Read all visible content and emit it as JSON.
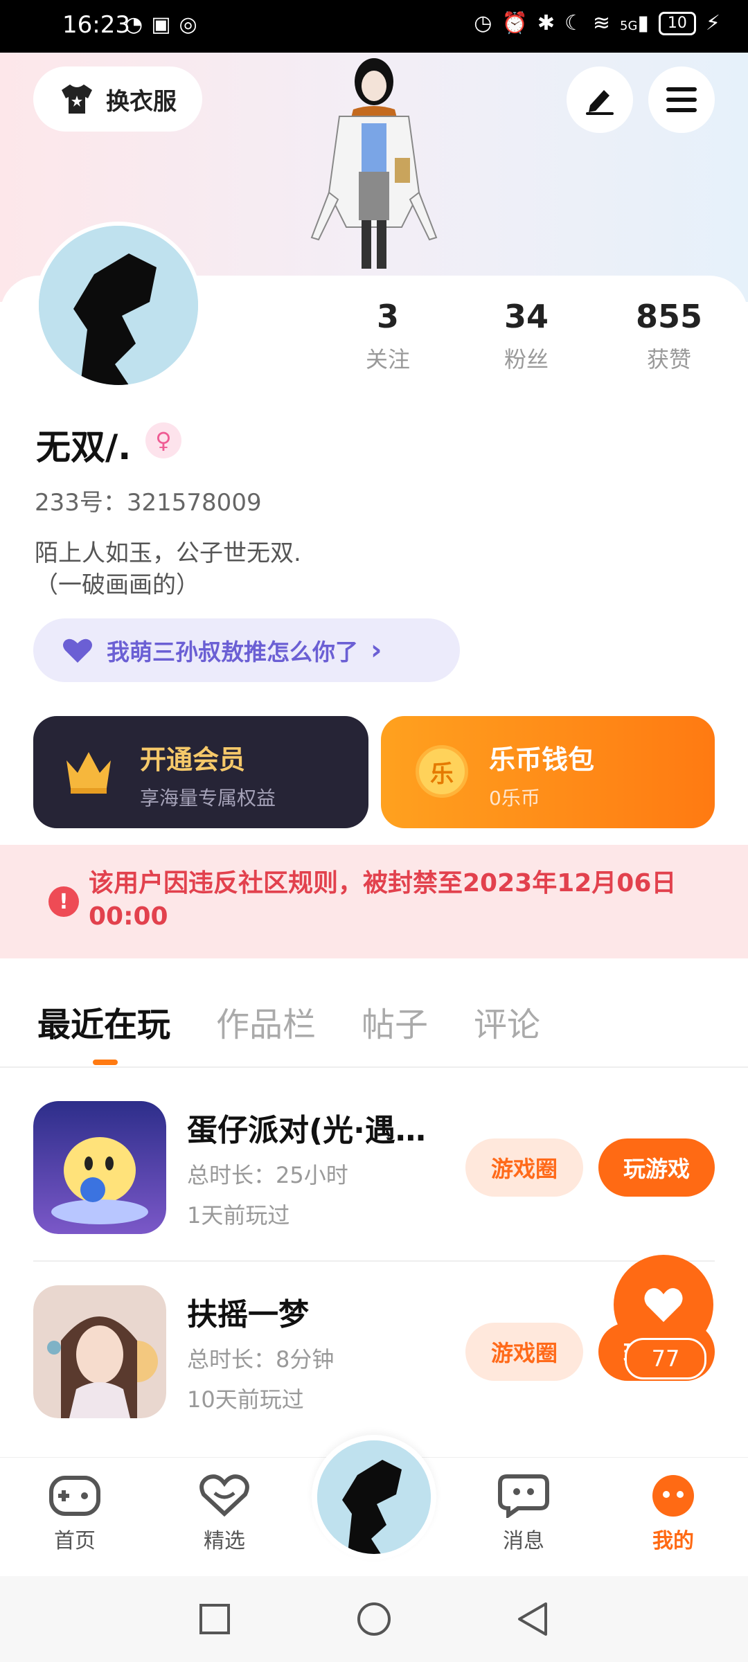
{
  "status_bar": {
    "time": "16:23",
    "battery": "10",
    "signal": "5G"
  },
  "header": {
    "outfit_label": "换衣服"
  },
  "profile": {
    "stats": [
      {
        "value": "3",
        "label": "关注"
      },
      {
        "value": "34",
        "label": "粉丝"
      },
      {
        "value": "855",
        "label": "获赞"
      }
    ],
    "name": "无双/.",
    "gender_symbol": "♀",
    "uid": "233号：321578009",
    "bio_line1": "陌上人如玉，公子世无双.",
    "bio_line2": "（一破画画的）",
    "tag_label": "我萌三孙叔敖推怎么你了",
    "tag_chevron": "›"
  },
  "cards": {
    "vip_title": "开通会员",
    "vip_sub": "享海量专属权益",
    "wallet_title": "乐币钱包",
    "wallet_sub": "0乐币",
    "wallet_coin": "乐"
  },
  "ban_notice": {
    "icon": "!",
    "text": "该用户因违反社区规则，被封禁至2023年12月06日 00:00"
  },
  "tabs": [
    "最近在玩",
    "作品栏",
    "帖子",
    "评论"
  ],
  "games": [
    {
      "title": "蛋仔派对(光·遇…",
      "playtime": "总时长：25小时",
      "last_played": "1天前玩过",
      "circle_label": "游戏圈",
      "play_label": "玩游戏"
    },
    {
      "title": "扶摇一梦",
      "playtime": "总时长：8分钟",
      "last_played": "10天前玩过",
      "circle_label": "游戏圈",
      "play_label": "玩游戏"
    }
  ],
  "like_fab": {
    "count": "77"
  },
  "bottom_nav": [
    {
      "label": "首页",
      "icon": "gamepad-icon"
    },
    {
      "label": "精选",
      "icon": "heart-chat-icon"
    },
    {
      "label": "消息",
      "icon": "message-icon"
    },
    {
      "label": "我的",
      "icon": "profile-face-icon"
    }
  ],
  "colors": {
    "accent": "#ff6a14",
    "ban_text": "#e2414d",
    "tag_text": "#6b5fd4",
    "vip_bg": "#262436"
  }
}
